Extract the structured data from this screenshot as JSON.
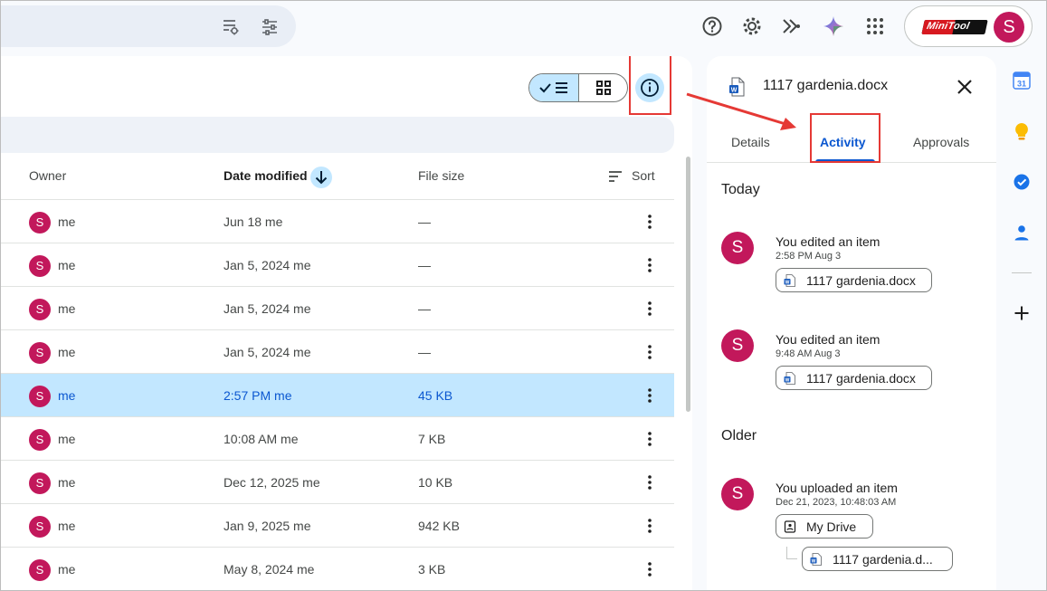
{
  "top_bar": {
    "search_icons": [
      "search-options-icon",
      "tune-icon"
    ],
    "icons": [
      "help-icon",
      "settings-icon",
      "gemini-extension-icon",
      "gemini-icon",
      "apps-icon"
    ],
    "account": {
      "brand": "MiniTool",
      "avatar_letter": "S"
    }
  },
  "toolbar": {
    "view_list_icon": "list-view-icon",
    "view_grid_icon": "grid-view-icon",
    "info_icon": "info-icon"
  },
  "table": {
    "headers": {
      "owner": "Owner",
      "date_modified": "Date modified",
      "file_size": "File size",
      "sort": "Sort"
    },
    "rows": [
      {
        "avatar": "S",
        "owner": "me",
        "date": "Jun 18 me",
        "size": "—",
        "selected": false
      },
      {
        "avatar": "S",
        "owner": "me",
        "date": "Jan 5, 2024 me",
        "size": "—",
        "selected": false
      },
      {
        "avatar": "S",
        "owner": "me",
        "date": "Jan 5, 2024 me",
        "size": "—",
        "selected": false
      },
      {
        "avatar": "S",
        "owner": "me",
        "date": "Jan 5, 2024 me",
        "size": "—",
        "selected": false
      },
      {
        "avatar": "S",
        "owner": "me",
        "date": "2:57 PM me",
        "size": "45 KB",
        "selected": true
      },
      {
        "avatar": "S",
        "owner": "me",
        "date": "10:08 AM me",
        "size": "7 KB",
        "selected": false
      },
      {
        "avatar": "S",
        "owner": "me",
        "date": "Dec 12, 2025 me",
        "size": "10 KB",
        "selected": false
      },
      {
        "avatar": "S",
        "owner": "me",
        "date": "Jan 9, 2025 me",
        "size": "942 KB",
        "selected": false
      },
      {
        "avatar": "S",
        "owner": "me",
        "date": "May 8, 2024 me",
        "size": "3 KB",
        "selected": false
      }
    ]
  },
  "details": {
    "file_name": "1117 gardenia.docx",
    "tabs": [
      "Details",
      "Activity",
      "Approvals"
    ],
    "active_tab": "Activity",
    "sections": {
      "today": "Today",
      "older": "Older"
    },
    "activities": [
      {
        "avatar": "S",
        "action": "You edited an item",
        "time": "2:58 PM Aug 3",
        "item": "1117 gardenia.docx"
      },
      {
        "avatar": "S",
        "action": "You edited an item",
        "time": "9:48 AM Aug 3",
        "item": "1117 gardenia.docx"
      },
      {
        "avatar": "S",
        "action": "You uploaded an item",
        "time": "Dec 21, 2023, 10:48:03 AM",
        "folder": "My Drive",
        "item": "1117 gardenia.d..."
      }
    ]
  },
  "right_rail": [
    "calendar-icon",
    "keep-icon",
    "tasks-icon",
    "contacts-icon",
    "add-icon"
  ],
  "calendar_day": "31",
  "colors": {
    "accent": "#0b57d0",
    "selected_row": "#c2e7ff",
    "avatar": "#c2185b",
    "annotation": "#e53935"
  }
}
